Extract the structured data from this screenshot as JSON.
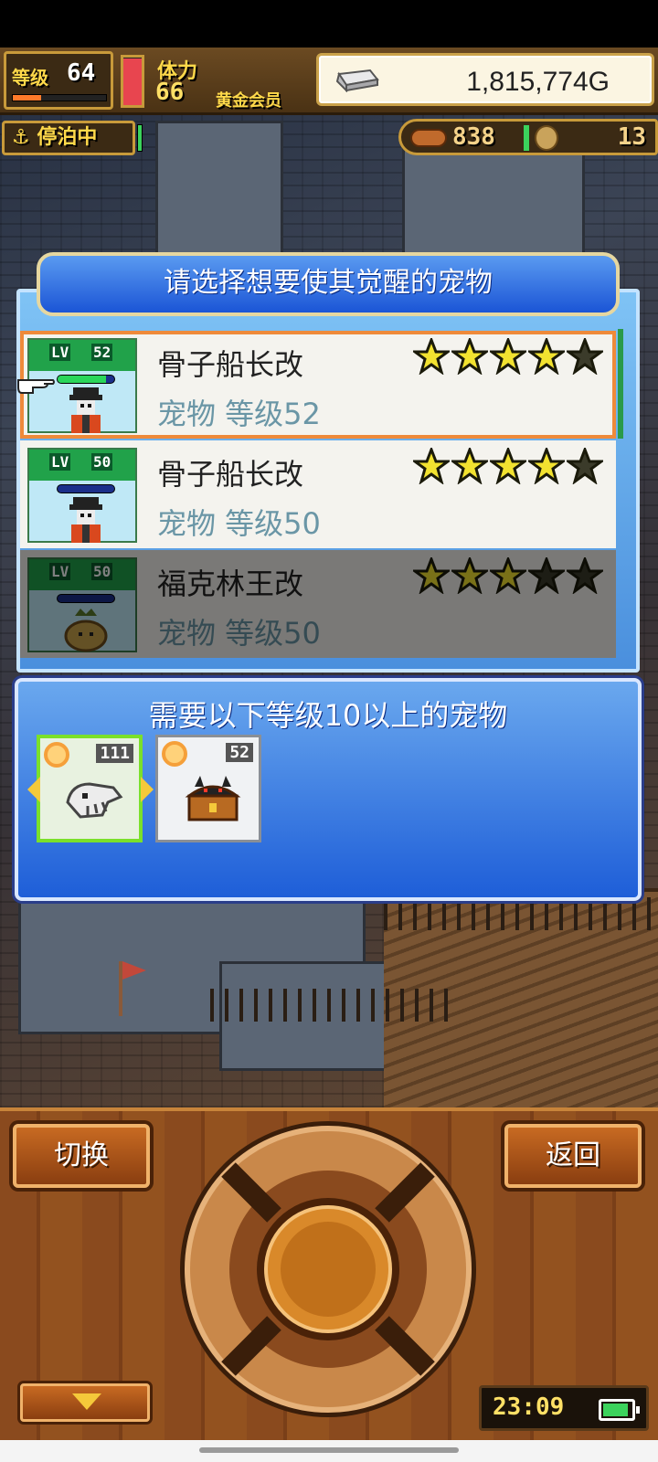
{
  "hud": {
    "level_label": "等级",
    "level_value": "64",
    "level_progress": 0.3,
    "stamina_label": "体力",
    "stamina_value": "66",
    "stamina_fill": 0.98,
    "member_badge": "黄金会员",
    "gold_value": "1,815,774G",
    "dock_status": "停泊中",
    "food_value": "838",
    "coin_value": "13"
  },
  "dialog": {
    "title": "请选择想要使其觉醒的宠物",
    "pets": [
      {
        "lv_tag": "LV",
        "level": "52",
        "name": "骨子船长改",
        "meta": "宠物 等级52",
        "stars_filled": 4,
        "stars_total": 5,
        "bar_fill": 0.85,
        "state": "selected",
        "sprite": "skeleton-captain-sprite"
      },
      {
        "lv_tag": "LV",
        "level": "50",
        "name": "骨子船长改",
        "meta": "宠物 等级50",
        "stars_filled": 4,
        "stars_total": 5,
        "bar_fill": 0.0,
        "state": "normal",
        "sprite": "skeleton-captain-sprite"
      },
      {
        "lv_tag": "LV",
        "level": "50",
        "name": "福克林王改",
        "meta": "宠物 等级50",
        "stars_filled": 3,
        "stars_total": 5,
        "bar_fill": 0.0,
        "state": "disabled",
        "sprite": "pouch-creature-sprite"
      }
    ]
  },
  "requirement": {
    "title": "需要以下等级10以上的宠物",
    "slots": [
      {
        "level": "111",
        "sprite": "bone-dragon-sprite",
        "active": true
      },
      {
        "level": "52",
        "sprite": "treasure-chest-cat-sprite",
        "active": false
      }
    ]
  },
  "controls": {
    "switch_label": "切换",
    "back_label": "返回",
    "clock": "23:09",
    "battery_level": 0.9
  },
  "colors": {
    "star_filled": "#f2e230",
    "star_empty": "#3b3b2a",
    "selected_outline": "#ee8a3a",
    "panel_blue": "#1e5ed8",
    "wood": "#8a4a1e"
  }
}
